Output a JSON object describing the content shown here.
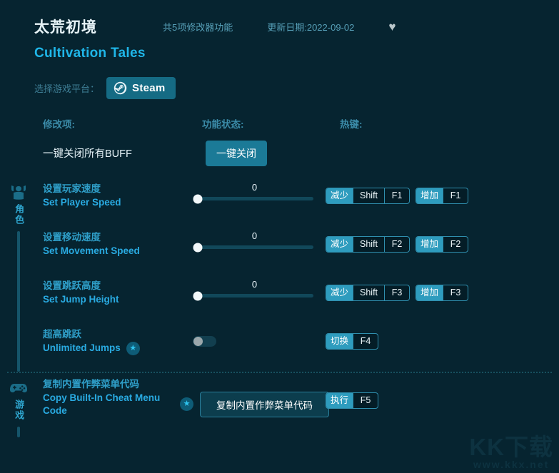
{
  "header": {
    "title_cn": "太荒初境",
    "title_en": "Cultivation Tales",
    "feature_count": "共5项修改器功能",
    "update_date": "更新日期:2022-09-02",
    "favorite_icon": "heart-icon"
  },
  "platform": {
    "label": "选择游戏平台：",
    "selected": "Steam",
    "icon": "steam-icon"
  },
  "columns": {
    "mod_item": "修改项:",
    "function_state": "功能状态:",
    "hotkey": "热键:"
  },
  "top_row": {
    "label": "一键关闭所有BUFF",
    "button": "一键关闭"
  },
  "sections": [
    {
      "category_cn": "角色",
      "icon": "character-icon",
      "rows": [
        {
          "name_cn": "设置玩家速度",
          "name_en": "Set Player Speed",
          "control": "slider",
          "value": "0",
          "thumb_percent": 2,
          "premium": false,
          "hotkeys": [
            {
              "action": "减少",
              "keys": [
                "Shift",
                "F1"
              ]
            },
            {
              "action": "增加",
              "keys": [
                "F1"
              ]
            }
          ]
        },
        {
          "name_cn": "设置移动速度",
          "name_en": "Set Movement Speed",
          "control": "slider",
          "value": "0",
          "thumb_percent": 2,
          "premium": false,
          "hotkeys": [
            {
              "action": "减少",
              "keys": [
                "Shift",
                "F2"
              ]
            },
            {
              "action": "增加",
              "keys": [
                "F2"
              ]
            }
          ]
        },
        {
          "name_cn": "设置跳跃高度",
          "name_en": "Set Jump Height",
          "control": "slider",
          "value": "0",
          "thumb_percent": 2,
          "premium": false,
          "hotkeys": [
            {
              "action": "减少",
              "keys": [
                "Shift",
                "F3"
              ]
            },
            {
              "action": "增加",
              "keys": [
                "F3"
              ]
            }
          ]
        },
        {
          "name_cn": "超高跳跃",
          "name_en": "Unlimited Jumps",
          "control": "toggle",
          "toggle_on": false,
          "premium": true,
          "premium_icon": "star-icon",
          "hotkeys": [
            {
              "action": "切换",
              "keys": [
                "F4"
              ]
            }
          ]
        }
      ]
    },
    {
      "category_cn": "游戏",
      "icon": "gamepad-icon",
      "rows": [
        {
          "name_cn": "复制内置作弊菜单代码",
          "name_en": "Copy Built-In Cheat Menu Code",
          "control": "action",
          "action_label": "复制内置作弊菜单代码",
          "premium": true,
          "premium_icon": "star-icon",
          "hotkeys": [
            {
              "action": "执行",
              "keys": [
                "F5"
              ]
            }
          ]
        }
      ]
    }
  ],
  "watermark": {
    "main": "KK下载",
    "sub": "www.kkx.net"
  },
  "colors": {
    "background": "#062430",
    "accent_cyan": "#29abe2",
    "accent_teal": "#2e9cbe",
    "steam_button": "#156b84"
  }
}
